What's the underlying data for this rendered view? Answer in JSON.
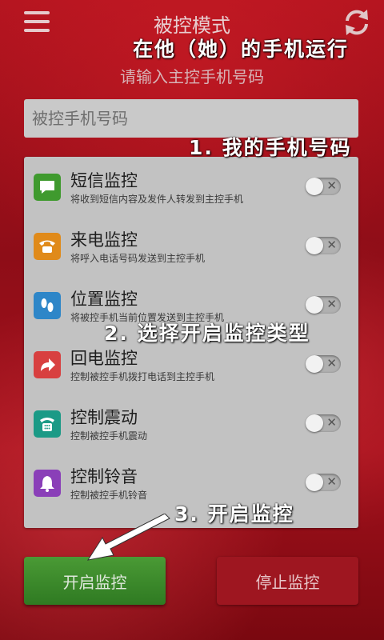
{
  "header": {
    "title": "被控模式",
    "menu_icon": "hamburger-menu-icon",
    "refresh_icon": "refresh-icon"
  },
  "annotations": {
    "run_on_phone": "在他（她）的手机运行",
    "step1": "1. 我的手机号码",
    "step2": "2. 选择开启监控类型",
    "step3": "3. 开启监控"
  },
  "form": {
    "subtitle": "请输入主控手机号码",
    "phone_placeholder": "被控手机号码",
    "phone_value": ""
  },
  "monitors": [
    {
      "title": "短信监控",
      "desc": "将收到短信内容及发件人转发到主控手机",
      "icon": "sms-icon",
      "color": "#3f9a2e",
      "enabled": false
    },
    {
      "title": "来电监控",
      "desc": "将呼入电话号码发送到主控手机",
      "icon": "phone-icon",
      "color": "#e08a1a",
      "enabled": false
    },
    {
      "title": "位置监控",
      "desc": "将被控手机当前位置发送到主控手机",
      "icon": "footprints-icon",
      "color": "#2e86c8",
      "enabled": false
    },
    {
      "title": "回电监控",
      "desc": "控制被控手机拨打电话到主控手机",
      "icon": "call-back-icon",
      "color": "#d84040",
      "enabled": false
    },
    {
      "title": "控制震动",
      "desc": "控制被控手机震动",
      "icon": "vibrate-icon",
      "color": "#1b9a86",
      "enabled": false
    },
    {
      "title": "控制铃音",
      "desc": "控制被控手机铃音",
      "icon": "bell-icon",
      "color": "#8a3fb8",
      "enabled": false
    }
  ],
  "buttons": {
    "start": "开启监控",
    "stop": "停止监控"
  },
  "colors": {
    "background": "#a3111c",
    "start_button": "#3b8a2b",
    "stop_button": "#9e1620",
    "panel": "#c2c2c2"
  }
}
